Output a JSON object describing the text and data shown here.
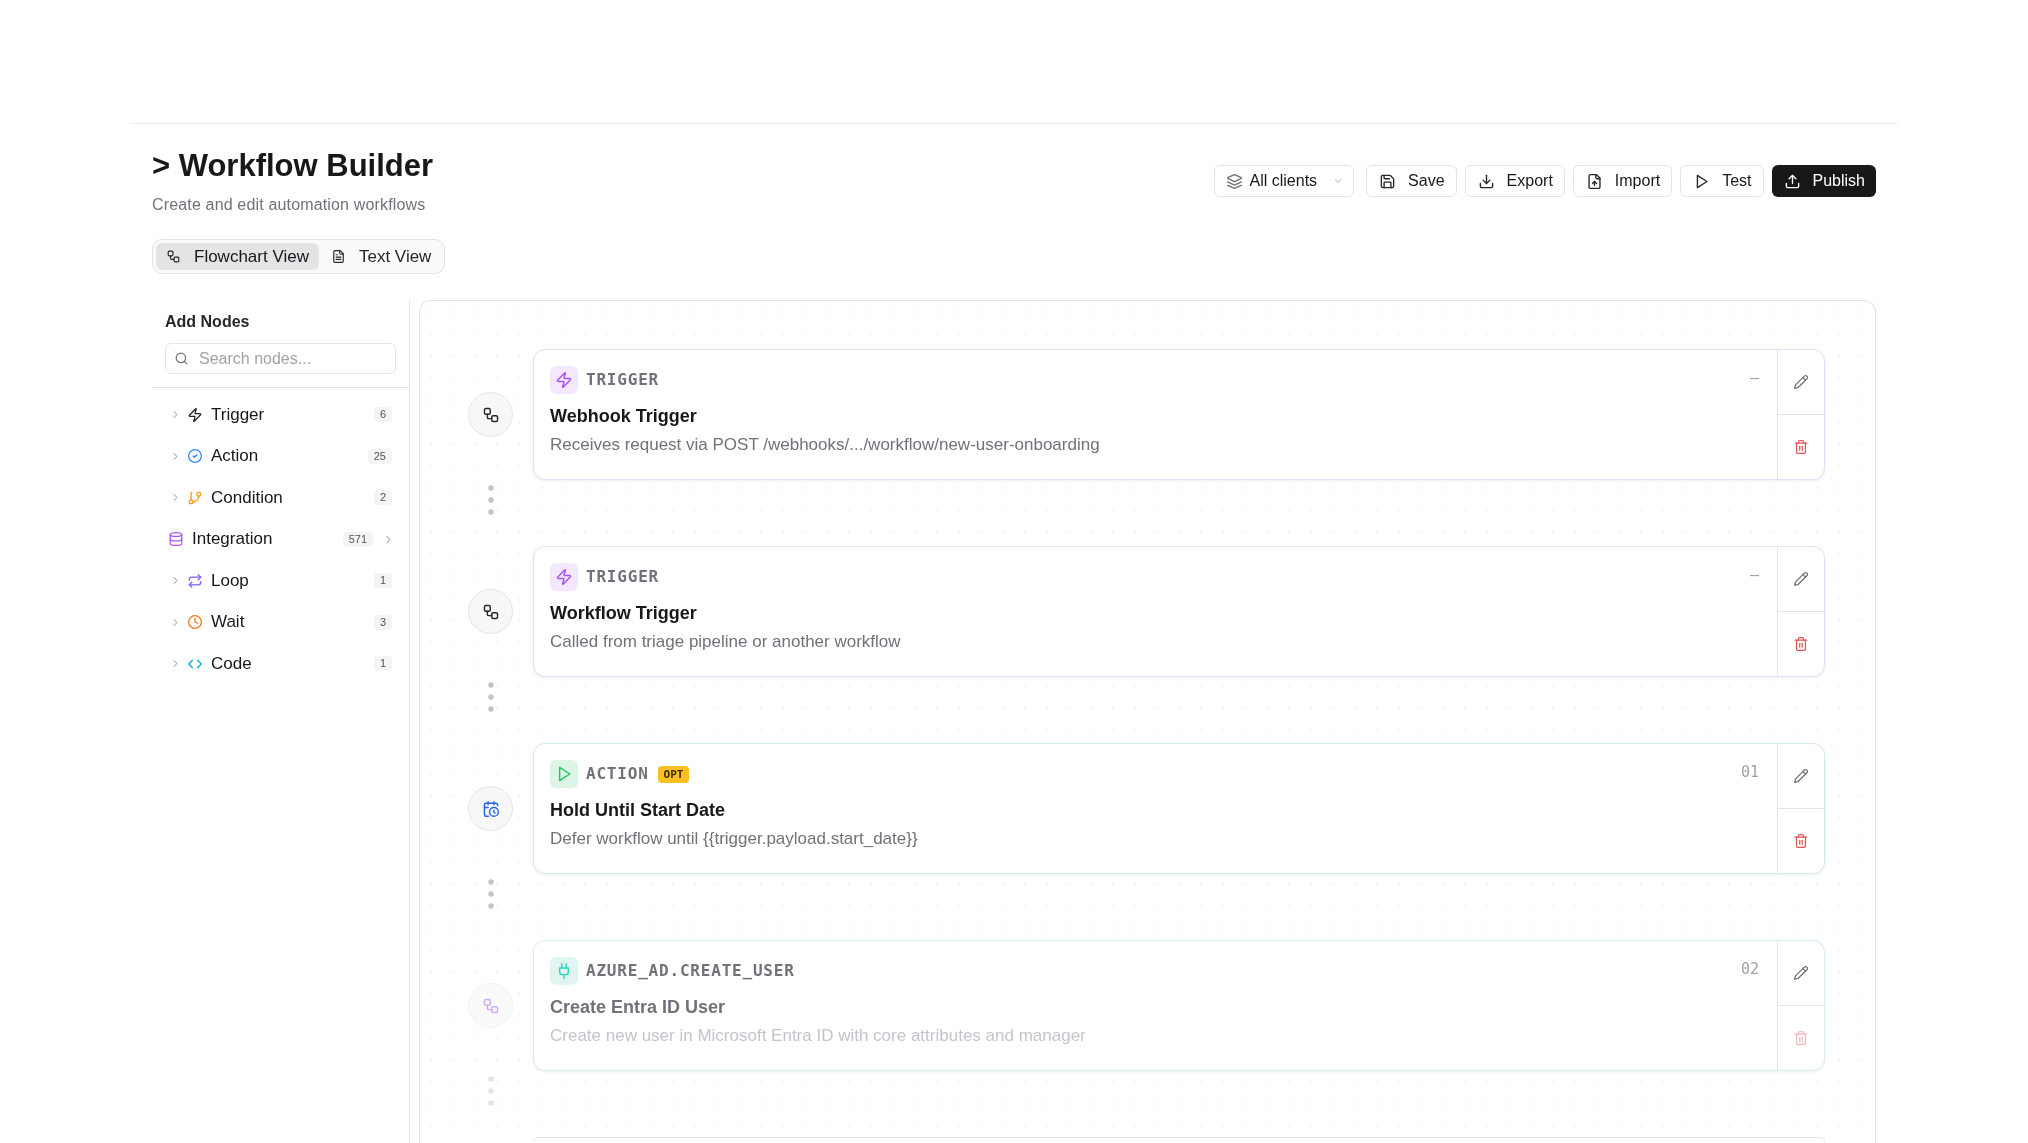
{
  "page": {
    "title": "> Workflow Builder",
    "subtitle": "Create and edit automation workflows"
  },
  "toolbar": [
    {
      "kind": "dropdown",
      "label": "All clients"
    },
    {
      "kind": "button",
      "label": "Save"
    },
    {
      "kind": "button",
      "label": "Export"
    },
    {
      "kind": "button",
      "label": "Import"
    },
    {
      "kind": "button",
      "label": "Test"
    },
    {
      "kind": "primary",
      "label": "Publish"
    }
  ],
  "view_tabs": [
    {
      "label": "Flowchart View",
      "selected": true
    },
    {
      "label": "Text View",
      "selected": false
    }
  ],
  "sidebar": {
    "title": "Add Nodes",
    "search": {
      "placeholder": "Search nodes..."
    },
    "items": [
      {
        "kind": "group",
        "label": "Trigger",
        "count": "6",
        "expanded": false
      },
      {
        "kind": "group",
        "label": "Action",
        "count": "25",
        "expanded": false
      },
      {
        "kind": "group",
        "label": "Condition",
        "count": "2",
        "expanded": false
      },
      {
        "kind": "link",
        "label": "Integration",
        "count": "571"
      },
      {
        "kind": "group",
        "label": "Loop",
        "count": "1",
        "expanded": false
      },
      {
        "kind": "group",
        "label": "Wait",
        "count": "3",
        "expanded": false
      },
      {
        "kind": "group",
        "label": "Code",
        "count": "1",
        "expanded": false
      }
    ]
  },
  "nodes": [
    {
      "kind": "trigger",
      "type": "TRIGGER",
      "title": "Webhook Trigger",
      "description": "Receives request via POST /webhooks/.../workflow/new-user-onboarding",
      "step": "—",
      "dimmed": false
    },
    {
      "kind": "trigger",
      "type": "TRIGGER",
      "title": "Workflow Trigger",
      "description": "Called from triage pipeline or another workflow",
      "step": "—",
      "dimmed": false
    },
    {
      "kind": "action",
      "type": "ACTION",
      "badge": "OPT",
      "title": "Hold Until Start Date",
      "description": "Defer workflow until {{trigger.payload.start_date}}",
      "step": "01",
      "dimmed": false
    },
    {
      "kind": "integration",
      "type": "AZURE_AD.CREATE_USER",
      "title": "Create Entra ID User",
      "description": "Create new user in Microsoft Entra ID with core attributes and manager",
      "step": "02",
      "dimmed": true
    }
  ],
  "canvas": {
    "more_nodes_below": true
  }
}
